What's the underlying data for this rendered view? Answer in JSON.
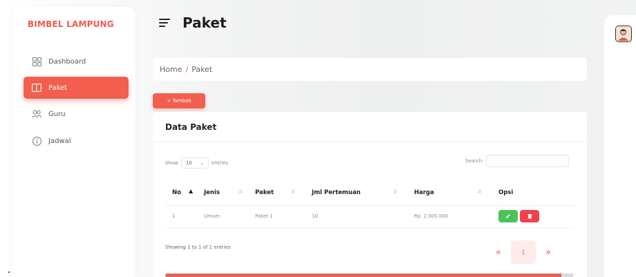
{
  "app": {
    "brand": "BIMBEL LAMPUNG",
    "page_title": "Paket"
  },
  "sidebar": {
    "items": [
      {
        "label": "Dashboard",
        "icon": "grid-icon",
        "active": false
      },
      {
        "label": "Paket",
        "icon": "book-icon",
        "active": true
      },
      {
        "label": "Guru",
        "icon": "users-icon",
        "active": false
      },
      {
        "label": "Jadwal",
        "icon": "info-icon",
        "active": false
      }
    ]
  },
  "breadcrumb": {
    "home": "Home",
    "separator": "/",
    "current": "Paket"
  },
  "actions": {
    "add_label": "+ Tambah"
  },
  "card": {
    "title": "Data Paket"
  },
  "datatable": {
    "show_label": "Show",
    "length_value": "10",
    "entries_label": "entries",
    "search_label": "Search:",
    "search_value": "",
    "columns": [
      "No",
      "Jenis",
      "Paket",
      "Jml Pertemuan",
      "Harga",
      "Opsi"
    ],
    "rows": [
      {
        "no": "1",
        "jenis": "Umum",
        "paket": "Paket 1",
        "jml_pertemuan": "10",
        "harga": "Rp. 2.000.000"
      }
    ],
    "info": "Showing 1 to 1 of 1 entries",
    "pagination": {
      "prev": "«",
      "current": "1",
      "next": "»"
    }
  },
  "scroll_progress": 0.97,
  "colors": {
    "accent": "#f25f4f",
    "edit": "#4cc35a",
    "delete": "#f0424d"
  }
}
